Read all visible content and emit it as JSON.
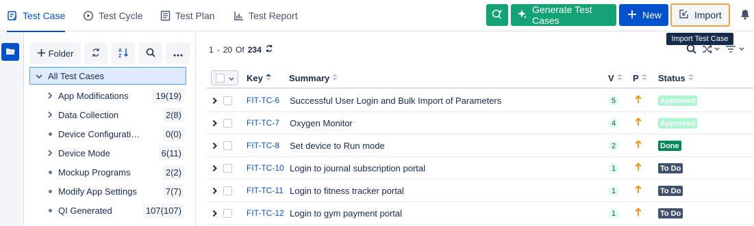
{
  "tabs": [
    {
      "label": "Test Case",
      "active": true,
      "icon": "test-case-icon"
    },
    {
      "label": "Test Cycle",
      "active": false,
      "icon": "test-cycle-icon"
    },
    {
      "label": "Test Plan",
      "active": false,
      "icon": "test-plan-icon"
    },
    {
      "label": "Test Report",
      "active": false,
      "icon": "test-report-icon"
    }
  ],
  "toolbar": {
    "generate_label": "Generate Test Cases",
    "new_label": "New",
    "import_label": "Import",
    "import_tooltip": "Import Test Case"
  },
  "folders": {
    "folder_button_label": "Folder",
    "root_label": "All Test Cases",
    "items": [
      {
        "name": "App Modifications",
        "count": "19(19)",
        "expandable": true
      },
      {
        "name": "Data Collection",
        "count": "2(8)",
        "expandable": true
      },
      {
        "name": "Device Configuration fo...",
        "count": "0(0)",
        "expandable": false
      },
      {
        "name": "Device Mode",
        "count": "6(11)",
        "expandable": true
      },
      {
        "name": "Mockup Programs",
        "count": "2(2)",
        "expandable": false
      },
      {
        "name": "Modify App Settings",
        "count": "7(7)",
        "expandable": false
      },
      {
        "name": "QI Generated",
        "count": "107(107)",
        "expandable": false
      }
    ]
  },
  "pager": {
    "start": "1",
    "sep": "-",
    "end": "20",
    "of_label": "Of",
    "total": "234"
  },
  "table": {
    "headers": {
      "key": "Key",
      "summary": "Summary",
      "version": "V",
      "priority": "P",
      "status": "Status"
    },
    "rows": [
      {
        "key": "FIT-TC-6",
        "summary": "Successful User Login and Bulk Import of Parameters",
        "version": "5",
        "status": "Approved"
      },
      {
        "key": "FIT-TC-7",
        "summary": "Oxygen Monitor",
        "version": "4",
        "status": "Approved"
      },
      {
        "key": "FIT-TC-8",
        "summary": "Set device to Run mode",
        "version": "2",
        "status": "Done"
      },
      {
        "key": "FIT-TC-10",
        "summary": "Login to journal subscription portal",
        "version": "1",
        "status": "To Do"
      },
      {
        "key": "FIT-TC-11",
        "summary": "Login to fitness tracker portal",
        "version": "1",
        "status": "To Do"
      },
      {
        "key": "FIT-TC-12",
        "summary": "Login to gym payment portal",
        "version": "1",
        "status": "To Do"
      }
    ]
  },
  "colors": {
    "accent": "#0052cc",
    "ai_green": "#14a374",
    "import_border": "#f5a142",
    "status_approved": "#abf5d1",
    "status_done": "#00875a",
    "status_todo": "#42526e",
    "priority": "#ff8b00"
  }
}
